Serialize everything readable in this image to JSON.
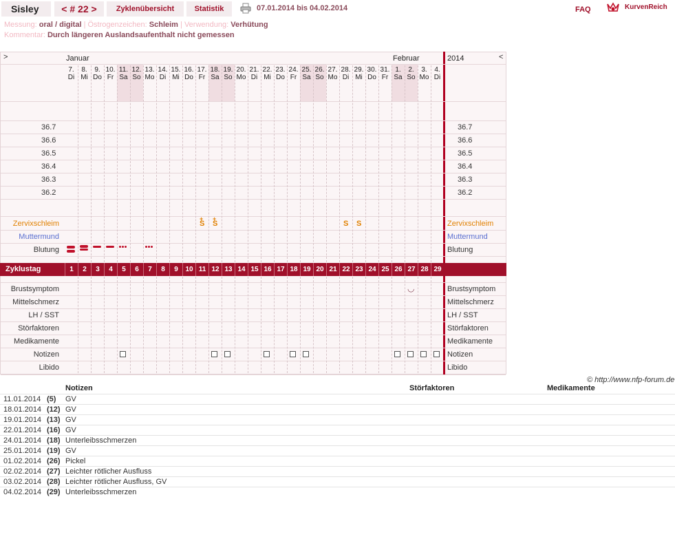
{
  "header": {
    "name": "Sisley",
    "cycle": "< # 22 >",
    "tabs": [
      "Zyklenübersicht",
      "Statistik"
    ],
    "date_range": "07.01.2014 bis 04.02.2014",
    "faq": "FAQ",
    "logo": "KurvenReich"
  },
  "meta": {
    "messung_label": "Messung:",
    "messung_value": "oral / digital",
    "oestrogen_label": "Östrogenzeichen:",
    "oestrogen_value": "Schleim",
    "verwendung_label": "Verwendung:",
    "verwendung_value": "Verhütung",
    "kommentar_label": "Kommentar:",
    "kommentar_value": "Durch längeren Auslandsaufenthalt nicht gemessen"
  },
  "chart": {
    "nav_left": ">",
    "nav_right": "<",
    "month1": "Januar",
    "month2": "Februar",
    "year": "2014",
    "days": [
      {
        "d": "7.",
        "w": "Di"
      },
      {
        "d": "8.",
        "w": "Mi"
      },
      {
        "d": "9.",
        "w": "Do"
      },
      {
        "d": "10.",
        "w": "Fr"
      },
      {
        "d": "11.",
        "w": "Sa"
      },
      {
        "d": "12.",
        "w": "So"
      },
      {
        "d": "13.",
        "w": "Mo"
      },
      {
        "d": "14.",
        "w": "Di"
      },
      {
        "d": "15.",
        "w": "Mi"
      },
      {
        "d": "16.",
        "w": "Do"
      },
      {
        "d": "17.",
        "w": "Fr"
      },
      {
        "d": "18.",
        "w": "Sa"
      },
      {
        "d": "19.",
        "w": "So"
      },
      {
        "d": "20.",
        "w": "Mo"
      },
      {
        "d": "21.",
        "w": "Di"
      },
      {
        "d": "22.",
        "w": "Mi"
      },
      {
        "d": "23.",
        "w": "Do"
      },
      {
        "d": "24.",
        "w": "Fr"
      },
      {
        "d": "25.",
        "w": "Sa"
      },
      {
        "d": "26.",
        "w": "So"
      },
      {
        "d": "27.",
        "w": "Mo"
      },
      {
        "d": "28.",
        "w": "Di"
      },
      {
        "d": "29.",
        "w": "Mi"
      },
      {
        "d": "30.",
        "w": "Do"
      },
      {
        "d": "31.",
        "w": "Fr"
      },
      {
        "d": "1.",
        "w": "Sa"
      },
      {
        "d": "2.",
        "w": "So"
      },
      {
        "d": "3.",
        "w": "Mo"
      },
      {
        "d": "4.",
        "w": "Di"
      }
    ],
    "temps": [
      "36.7",
      "36.6",
      "36.5",
      "36.4",
      "36.3",
      "36.2"
    ],
    "rows_top": [
      "Zervixschleim",
      "Muttermund",
      "Blutung"
    ],
    "zyklustag_label": "Zyklustag",
    "zyklustage": [
      "1",
      "2",
      "3",
      "4",
      "5",
      "6",
      "7",
      "8",
      "9",
      "10",
      "11",
      "12",
      "13",
      "14",
      "15",
      "16",
      "17",
      "18",
      "19",
      "20",
      "21",
      "22",
      "23",
      "24",
      "25",
      "26",
      "27",
      "28",
      "29"
    ],
    "rows_bottom": [
      "Brustsymptom",
      "Mittelschmerz",
      "LH / SST",
      "Störfaktoren",
      "Medikamente",
      "Notizen",
      "Libido"
    ],
    "cervix_marks": [
      {
        "day": 11,
        "sym": "S",
        "plus": "+"
      },
      {
        "day": 12,
        "sym": "S",
        "plus": "+"
      },
      {
        "day": 22,
        "sym": "S",
        "plus": ""
      },
      {
        "day": 23,
        "sym": "S",
        "plus": ""
      }
    ],
    "bleeding": [
      {
        "day": 1,
        "type": "heavy"
      },
      {
        "day": 2,
        "type": "medium"
      },
      {
        "day": 3,
        "type": "light"
      },
      {
        "day": 4,
        "type": "light"
      },
      {
        "day": 5,
        "type": "spot"
      },
      {
        "day": 7,
        "type": "spot"
      }
    ],
    "breast_day": 27,
    "note_days": [
      5,
      12,
      13,
      16,
      18,
      19,
      26,
      27,
      28,
      29
    ]
  },
  "copyright": "© http://www.nfp-forum.de",
  "table": {
    "headers": [
      "Notizen",
      "Störfaktoren",
      "Medikamente"
    ],
    "rows": [
      {
        "date": "11.01.2014",
        "day": "(5)",
        "note": "GV"
      },
      {
        "date": "18.01.2014",
        "day": "(12)",
        "note": "GV"
      },
      {
        "date": "19.01.2014",
        "day": "(13)",
        "note": "GV"
      },
      {
        "date": "22.01.2014",
        "day": "(16)",
        "note": "GV"
      },
      {
        "date": "24.01.2014",
        "day": "(18)",
        "note": "Unterleibsschmerzen"
      },
      {
        "date": "25.01.2014",
        "day": "(19)",
        "note": "GV"
      },
      {
        "date": "01.02.2014",
        "day": "(26)",
        "note": "Pickel"
      },
      {
        "date": "02.02.2014",
        "day": "(27)",
        "note": "Leichter rötlicher Ausfluss"
      },
      {
        "date": "03.02.2014",
        "day": "(28)",
        "note": "Leichter rötlicher Ausfluss, GV"
      },
      {
        "date": "04.02.2014",
        "day": "(29)",
        "note": "Unterleibsschmerzen"
      }
    ]
  }
}
